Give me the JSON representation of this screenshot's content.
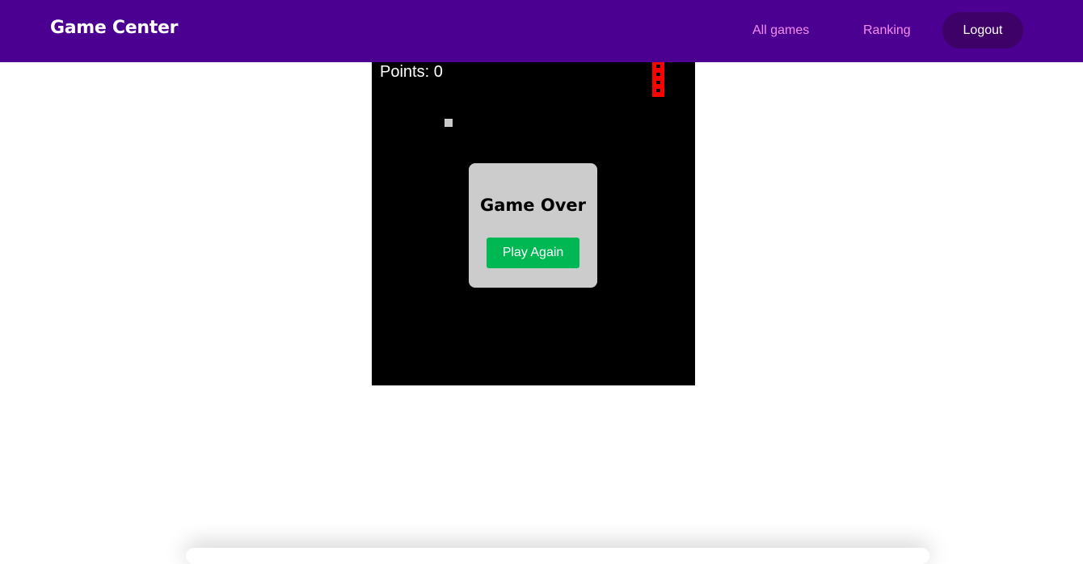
{
  "header": {
    "brand": "Game Center",
    "nav": {
      "all_games": "All games",
      "ranking": "Ranking",
      "logout": "Logout"
    }
  },
  "game": {
    "points_label": "Points: 0",
    "score": 0,
    "overlay": {
      "title": "Game Over",
      "play_again": "Play Again"
    }
  },
  "colors": {
    "navbar": "#4b0092",
    "nav_link": "#f58cf0",
    "logout_bg": "#3e0168",
    "board": "#000000",
    "snake": "#ff0000",
    "food": "#cccccc",
    "overlay": "#cccccc",
    "play_button": "#00b853"
  }
}
